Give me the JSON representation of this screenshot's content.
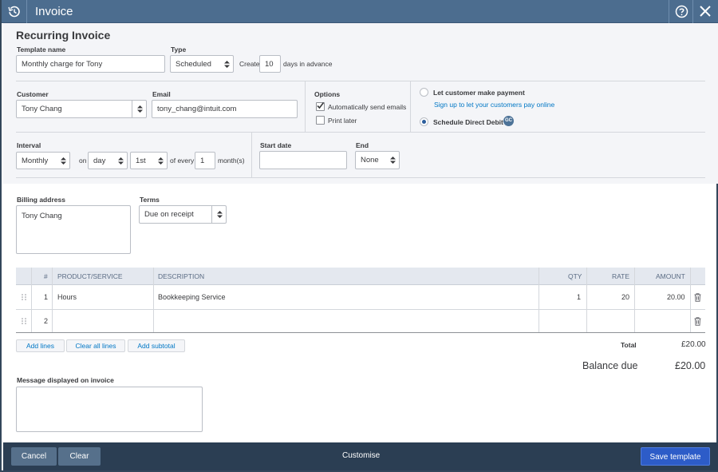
{
  "window": {
    "title": "Invoice",
    "icons": [
      "logo-icon",
      "help-icon",
      "close-icon"
    ]
  },
  "header": {
    "title": "Recurring Invoice"
  },
  "template": {
    "name_label": "Template name",
    "name_value": "Monthly charge for Tony",
    "type_label": "Type",
    "type_value": "Scheduled",
    "create_prefix": "Create",
    "create_days": "10",
    "create_suffix": "days in advance"
  },
  "customer": {
    "customer_label": "Customer",
    "customer_value": "Tony Chang",
    "email_label": "Email",
    "email_value": "tony_chang@intuit.com"
  },
  "options": {
    "label": "Options",
    "auto_send": {
      "label": "Automatically send emails",
      "checked": true
    },
    "print_later": {
      "label": "Print later",
      "checked": false
    }
  },
  "payment": {
    "let_customer_pay": {
      "label": "Let customer make payment",
      "selected": false
    },
    "signup_link": "Sign up to let your customers pay online",
    "direct_debit": {
      "label": "Schedule Direct Debit",
      "selected": true,
      "badge": "GC"
    }
  },
  "schedule": {
    "interval_label": "Interval",
    "interval_value": "Monthly",
    "on_label": "on",
    "day_value": "day",
    "date_value": "1st",
    "of_every_label": "of every",
    "every_value": "1",
    "unit_label": "month(s)",
    "start_label": "Start date",
    "start_value": "",
    "end_label": "End",
    "end_value": "None"
  },
  "billing": {
    "address_label": "Billing address",
    "address_value": "Tony Chang",
    "terms_label": "Terms",
    "terms_value": "Due on receipt"
  },
  "table": {
    "headers": {
      "num": "#",
      "product": "PRODUCT/SERVICE",
      "description": "DESCRIPTION",
      "qty": "QTY",
      "rate": "RATE",
      "amount": "AMOUNT"
    },
    "rows": [
      {
        "num": "1",
        "product": "Hours",
        "description": "Bookkeeping Service",
        "qty": "1",
        "rate": "20",
        "amount": "20.00"
      },
      {
        "num": "2",
        "product": "",
        "description": "",
        "qty": "",
        "rate": "",
        "amount": ""
      }
    ]
  },
  "line_actions": {
    "add_lines": "Add lines",
    "clear_all": "Clear all lines",
    "add_subtotal": "Add subtotal"
  },
  "totals": {
    "total_label": "Total",
    "total_value": "£20.00",
    "balance_label": "Balance due",
    "balance_value": "£20.00"
  },
  "message": {
    "label": "Message displayed on invoice",
    "value": ""
  },
  "footer": {
    "cancel": "Cancel",
    "clear": "Clear",
    "customise": "Customise",
    "save": "Save template"
  },
  "colors": {
    "titlebar": "#4c6d8f",
    "footer": "#2b3e53",
    "link": "#0077c5",
    "primary": "#2d5cc8"
  }
}
